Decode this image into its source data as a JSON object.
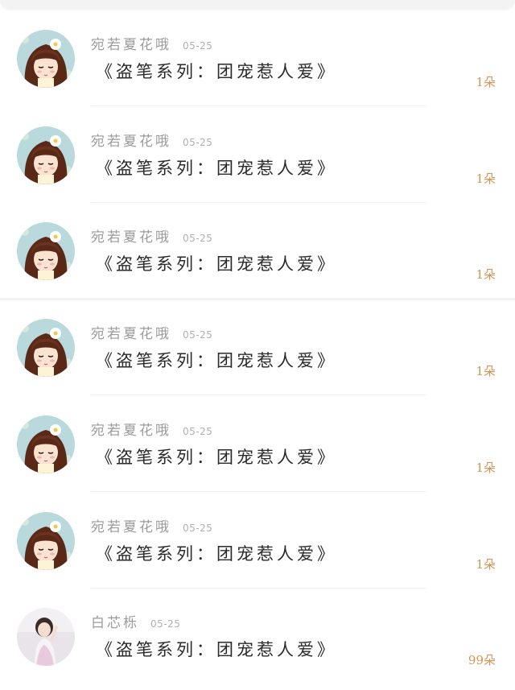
{
  "colors": {
    "gift_accent": "#d79355",
    "name_gray": "#9b9b9b",
    "title_text": "#2a2a2a",
    "separator": "#f0f0f0"
  },
  "rows": [
    {
      "avatar": "anime-girl-avatar",
      "name": "宛若夏花哦",
      "date": "05-25",
      "title": "《盗笔系列：团宠惹人爱》",
      "gift": "1朵"
    },
    {
      "avatar": "anime-girl-avatar",
      "name": "宛若夏花哦",
      "date": "05-25",
      "title": "《盗笔系列：团宠惹人爱》",
      "gift": "1朵"
    },
    {
      "avatar": "anime-girl-avatar",
      "name": "宛若夏花哦",
      "date": "05-25",
      "title": "《盗笔系列：团宠惹人爱》",
      "gift": "1朵"
    },
    {
      "avatar": "anime-girl-avatar",
      "name": "宛若夏花哦",
      "date": "05-25",
      "title": "《盗笔系列：团宠惹人爱》",
      "gift": "1朵"
    },
    {
      "avatar": "anime-girl-avatar",
      "name": "宛若夏花哦",
      "date": "05-25",
      "title": "《盗笔系列：团宠惹人爱》",
      "gift": "1朵"
    },
    {
      "avatar": "anime-girl-avatar",
      "name": "宛若夏花哦",
      "date": "05-25",
      "title": "《盗笔系列：团宠惹人爱》",
      "gift": "1朵"
    },
    {
      "avatar": "photo-girl-avatar",
      "name": "白芯栎",
      "date": "05-25",
      "title": "《盗笔系列：团宠惹人爱》",
      "gift": "99朵"
    }
  ]
}
